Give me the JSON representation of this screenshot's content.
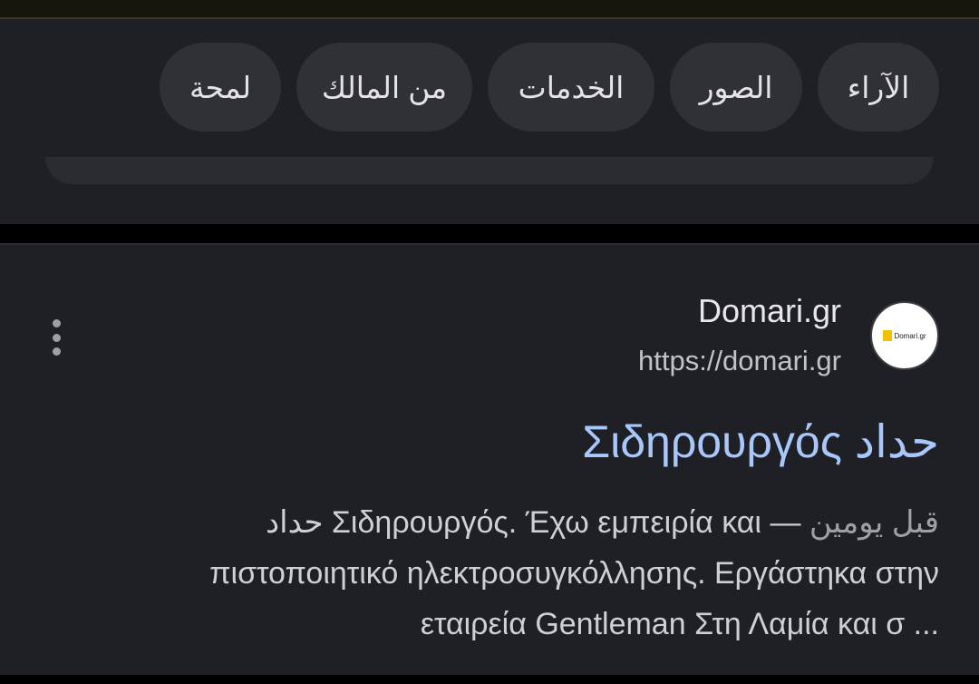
{
  "chips": [
    {
      "label": "الآراء"
    },
    {
      "label": "الصور"
    },
    {
      "label": "الخدمات"
    },
    {
      "label": "من المالك"
    },
    {
      "label": "لمحة"
    }
  ],
  "result": {
    "site_name": "Domari.gr",
    "url": "https://domari.gr",
    "favicon": "domari-logo-icon",
    "title": "Σιδηρουργός حداد",
    "date": "قبل يومين",
    "snippet_line1": "حداد Σιδηρουργός. Έχω εμπειρία και",
    "snippet_line2": "πιστοποιητικό ηλεκτροσυγκόλλησης. Εργάστηκα στην",
    "snippet_line3": "εταιρεία Gentleman Στη Λαμία και σ ..."
  },
  "colors": {
    "background": "#1f2025",
    "chip": "#303136",
    "link": "#a8c7fa"
  }
}
